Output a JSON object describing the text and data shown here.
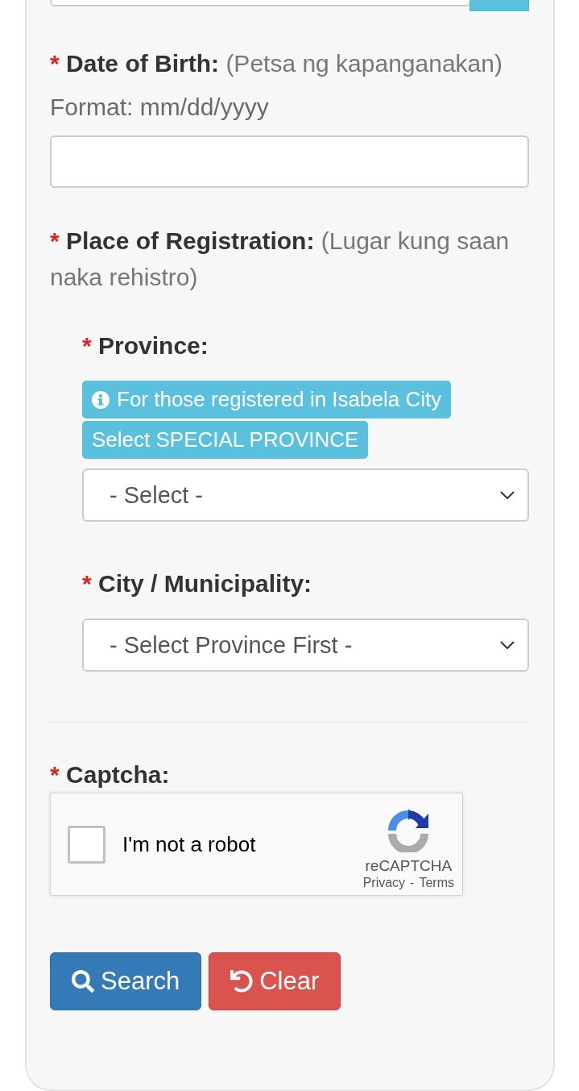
{
  "date_of_birth": {
    "required_mark": "*",
    "label": "Date of Birth:",
    "translation": "(Petsa ng kapanganakan)",
    "help_text": "Format: mm/dd/yyyy"
  },
  "place_of_registration": {
    "required_mark": "*",
    "label": "Place of Registration:",
    "translation": "(Lugar kung saan naka rehistro)",
    "fields": [
      {
        "required_mark": "*",
        "label": "Province:",
        "notices": [
          {
            "kind": "info",
            "text": "For those registered in Isabela City"
          },
          {
            "kind": "plain",
            "text": "Select SPECIAL PROVINCE"
          }
        ],
        "select_value": "- Select -"
      },
      {
        "required_mark": "*",
        "label": "City / Municipality:",
        "select_value": "- Select Province First -"
      }
    ]
  },
  "captcha": {
    "required_mark": "*",
    "label": "Captcha:",
    "checkbox_label": "I'm not a robot",
    "checked": false,
    "brand": "reCAPTCHA",
    "links": [
      "Privacy",
      "Terms"
    ],
    "link_separator": "-"
  },
  "buttons": [
    {
      "kind": "search",
      "label": "Search"
    },
    {
      "kind": "clear",
      "label": "Clear"
    }
  ]
}
